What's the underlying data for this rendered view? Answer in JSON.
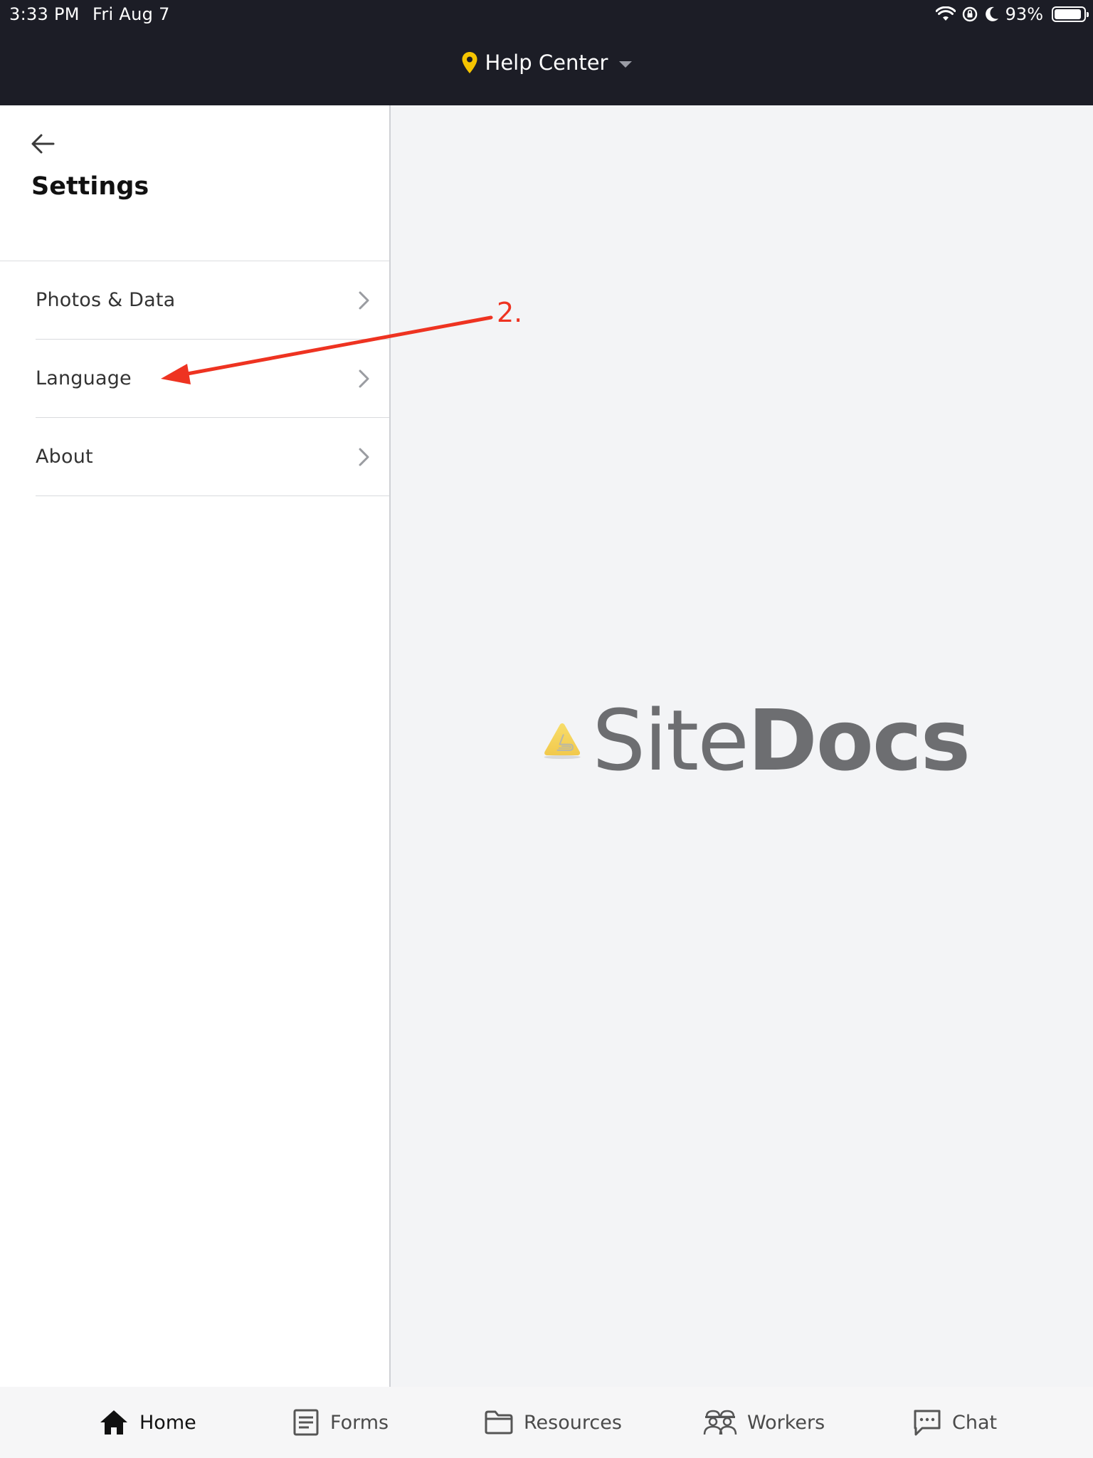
{
  "status_bar": {
    "time": "3:33 PM",
    "date": "Fri Aug 7",
    "battery_percent": "93%",
    "battery_level": 0.93
  },
  "header": {
    "location_label": "Help Center",
    "pin_color": "#f5c400"
  },
  "sidebar": {
    "title": "Settings",
    "items": [
      {
        "label": "Photos & Data"
      },
      {
        "label": "Language"
      },
      {
        "label": "About"
      }
    ]
  },
  "main": {
    "logo_site": "Site",
    "logo_docs": "Docs"
  },
  "annotation": {
    "label": "2.",
    "color": "#ee3321"
  },
  "tabbar": {
    "tabs": [
      {
        "label": "Home",
        "icon": "home-icon",
        "active": true
      },
      {
        "label": "Forms",
        "icon": "forms-icon",
        "active": false
      },
      {
        "label": "Resources",
        "icon": "folder-icon",
        "active": false
      },
      {
        "label": "Workers",
        "icon": "workers-icon",
        "active": false
      },
      {
        "label": "Chat",
        "icon": "chat-icon",
        "active": false
      }
    ]
  }
}
